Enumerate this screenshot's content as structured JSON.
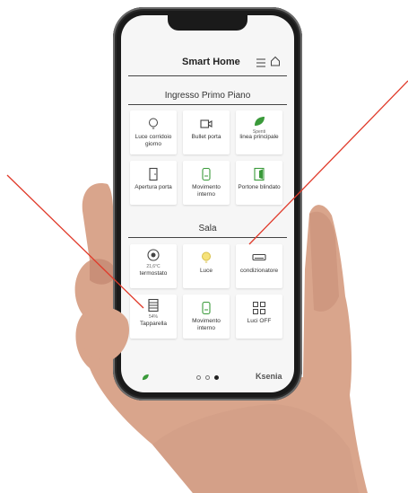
{
  "app": {
    "title": "Smart Home",
    "brand": "Ksenia",
    "accent_color": "#3a9a3a",
    "icons": {
      "menu": "menu-icon",
      "home": "home-icon"
    }
  },
  "sections": [
    {
      "title": "Ingresso Primo Piano",
      "tiles": [
        {
          "label": "Luce corridoio giorno",
          "icon": "bulb-icon"
        },
        {
          "label": "Bullet porta",
          "icon": "camera-icon"
        },
        {
          "value": "Spenti",
          "label": "linea principale",
          "icon": "leaf-icon"
        },
        {
          "label": "Apertura porta",
          "icon": "door-icon"
        },
        {
          "label": "Movimento interno",
          "icon": "motion-sensor-icon"
        },
        {
          "label": "Portone blindato",
          "icon": "door-open-icon"
        }
      ]
    },
    {
      "title": "Sala",
      "tiles": [
        {
          "value": "21,6°C",
          "label": "termostato",
          "icon": "thermostat-icon"
        },
        {
          "label": "Luce",
          "icon": "bulb-on-icon"
        },
        {
          "label": "condizionatore",
          "icon": "air-conditioner-icon"
        },
        {
          "value": "54%",
          "label": "Tapparella",
          "icon": "shutter-icon"
        },
        {
          "label": "Movimento interno",
          "icon": "motion-sensor-icon"
        },
        {
          "label": "Luci OFF",
          "icon": "scenario-icon"
        }
      ]
    }
  ],
  "pager": {
    "count": 3,
    "active_index": 2
  }
}
